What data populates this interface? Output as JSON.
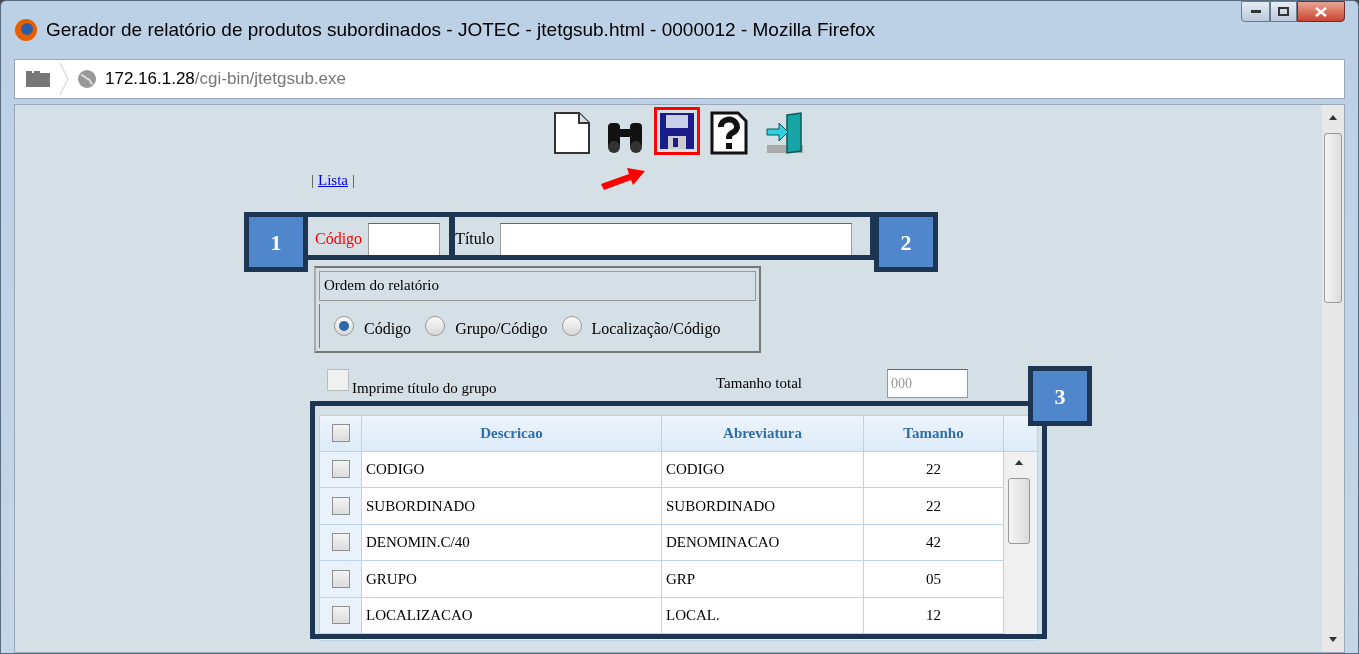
{
  "window": {
    "title": "Gerador de relatório de produtos subordinados - JOTEC - jtetgsub.html - 0000012 - Mozilla Firefox"
  },
  "address_bar": {
    "host": "172.16.1.28",
    "path": "/cgi-bin/jtetgsub.exe"
  },
  "toolbar": [
    {
      "kind": "new",
      "highlighted": false
    },
    {
      "kind": "search",
      "highlighted": false
    },
    {
      "kind": "save",
      "highlighted": true
    },
    {
      "kind": "help",
      "highlighted": false
    },
    {
      "kind": "exit",
      "highlighted": false
    }
  ],
  "nav": {
    "before": "|",
    "link": "Lista",
    "after": "|"
  },
  "codigo": {
    "label": "Código",
    "required": true
  },
  "titulo": {
    "label": "Título",
    "required": false
  },
  "order": {
    "title": "Ordem do relatório",
    "options": [
      {
        "label": "Código",
        "selected": true
      },
      {
        "label": "Grupo/Código",
        "selected": false
      },
      {
        "label": "Localização/Código",
        "selected": false
      }
    ]
  },
  "print_group_title": {
    "label": "Imprime título do grupo",
    "checked": false
  },
  "total_size": {
    "label": "Tamanho total",
    "placeholder": "000"
  },
  "table": {
    "all_checked": false,
    "columns": [
      "Descricao",
      "Abreviatura",
      "Tamanho"
    ],
    "rows": [
      {
        "checked": false,
        "cells": [
          "CODIGO",
          "CODIGO",
          "22"
        ]
      },
      {
        "checked": false,
        "cells": [
          "SUBORDINADO",
          "SUBORDINADO",
          "22"
        ]
      },
      {
        "checked": false,
        "cells": [
          "DENOMIN.C/40",
          "DENOMINACAO",
          "42"
        ]
      },
      {
        "checked": false,
        "cells": [
          "GRUPO",
          "GRP",
          "05"
        ]
      },
      {
        "checked": false,
        "cells": [
          "LOCALIZACAO",
          "LOCAL.",
          "12"
        ]
      }
    ]
  },
  "callouts": [
    "1",
    "2",
    "3"
  ]
}
